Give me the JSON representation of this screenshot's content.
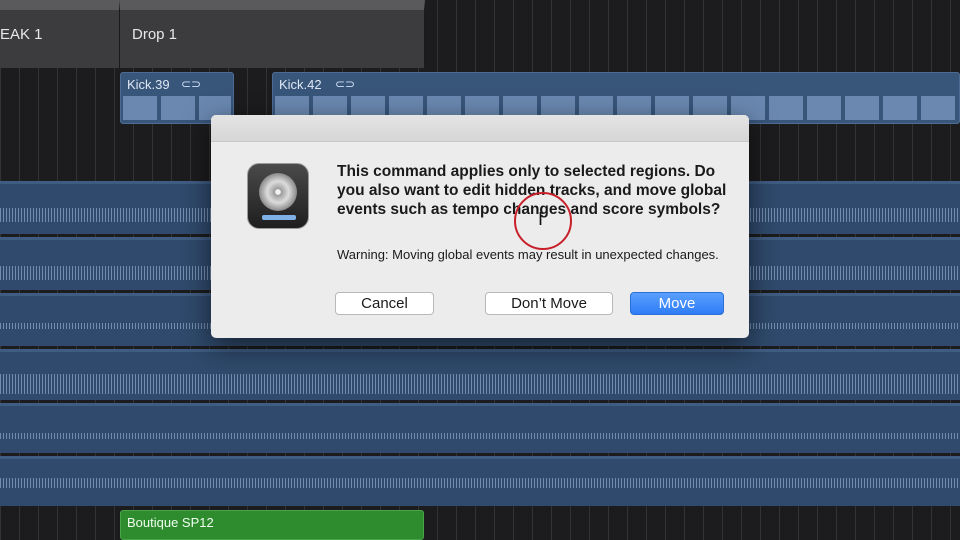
{
  "markers": [
    {
      "label": "EAK 1"
    },
    {
      "label": "Drop 1"
    }
  ],
  "regions": {
    "kick_a": {
      "label": "Kick.39"
    },
    "kick_b": {
      "label": "Kick.42"
    },
    "boutique": {
      "label": "Boutique SP12"
    }
  },
  "dialog": {
    "message": "This command applies only to selected regions. Do you also want to edit hidden tracks, and move global events such as tempo changes and score symbols?",
    "warning": "Warning: Moving global events may result in unexpected changes.",
    "buttons": {
      "cancel": "Cancel",
      "dont_move": "Don’t Move",
      "move": "Move"
    }
  },
  "icons": {
    "app": "logic-pro-icon",
    "loop": "loop-icon",
    "cursor": "text-cursor-icon"
  },
  "colors": {
    "region_blue": "#2f4a6c",
    "region_green": "#2e8b2e",
    "primary_button": "#2f7cf6"
  }
}
